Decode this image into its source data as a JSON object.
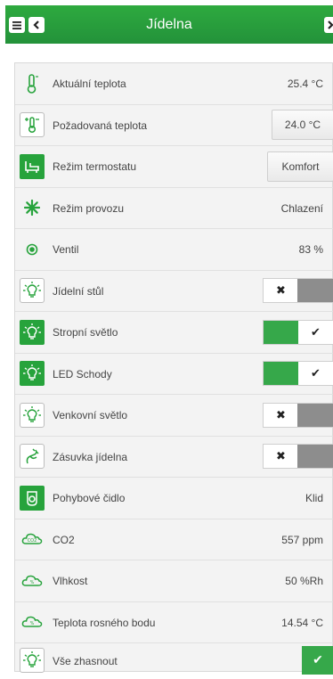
{
  "header": {
    "title": "Jídelna",
    "menu_icon": "hamburger-icon",
    "back_icon": "chevron-left-icon",
    "next_icon": "chevron-right-icon",
    "color": "#2eaa3f"
  },
  "rows": {
    "aktualni": {
      "label": "Aktuální teplota",
      "value": "25.4 °C",
      "icon": "thermometer-icon"
    },
    "pozadovana": {
      "label": "Požadovaná teplota",
      "value": "24.0 °C",
      "icon": "thermometer-adjust-icon"
    },
    "rezim_termostatu": {
      "label": "Režim termostatu",
      "value": "Komfort",
      "icon": "sofa-icon"
    },
    "rezim_provozu": {
      "label": "Režim provozu",
      "value": "Chlazení",
      "icon": "snowflake-icon"
    },
    "ventil": {
      "label": "Ventil",
      "value": "83 %",
      "icon": "valve-icon"
    },
    "jidelni_stul": {
      "label": "Jídelní stůl",
      "state": "off",
      "icon": "bulb-icon"
    },
    "stropni_svetlo": {
      "label": "Stropní světlo",
      "state": "on",
      "icon": "bulb-icon"
    },
    "led_schody": {
      "label": "LED Schody",
      "state": "on",
      "icon": "bulb-icon"
    },
    "venkovni_svetlo": {
      "label": "Venkovní světlo",
      "state": "off",
      "icon": "bulb-icon"
    },
    "zasuvka": {
      "label": "Zásuvka jídelna",
      "state": "off",
      "icon": "plug-icon"
    },
    "pohybove": {
      "label": "Pohybové čidlo",
      "value": "Klid",
      "icon": "motion-sensor-icon"
    },
    "co2": {
      "label": "CO2",
      "value": "557 ppm",
      "icon": "co2-cloud-icon"
    },
    "vlhkost": {
      "label": "Vlhkost",
      "value": "50 %Rh",
      "icon": "humidity-cloud-icon"
    },
    "rosny_bod": {
      "label": "Teplota rosného bodu",
      "value": "14.54 °C",
      "icon": "dewpoint-cloud-icon"
    },
    "vse_zhasnout": {
      "label": "Vše zhasnout",
      "icon": "bulb-icon"
    }
  },
  "colors": {
    "accent": "#27a33c",
    "toggle_off": "#8d8d8d"
  }
}
